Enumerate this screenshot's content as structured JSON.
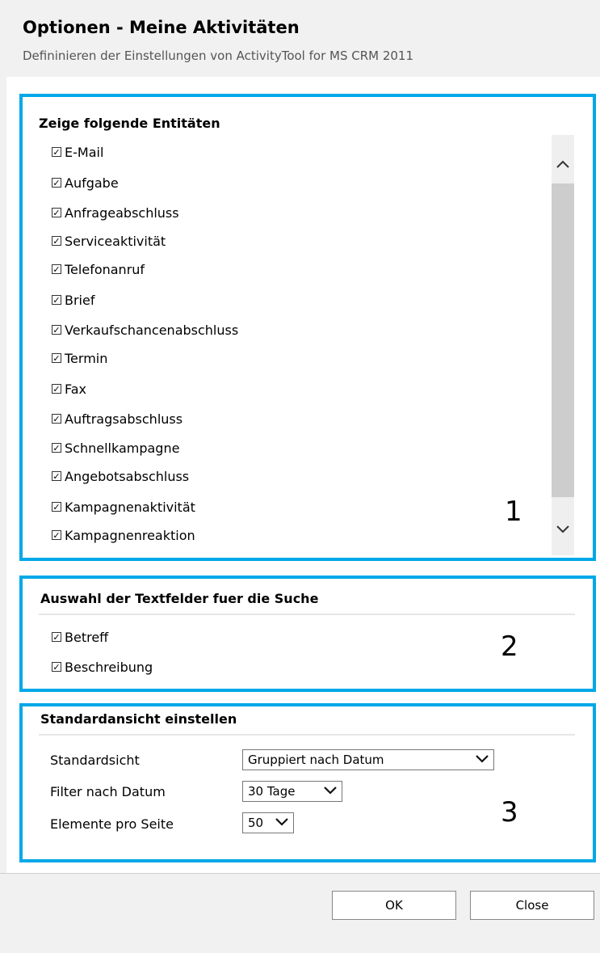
{
  "dialog": {
    "title": "Optionen - Meine Aktivitäten",
    "subtitle": "Defininieren der Einstellungen von ActivityTool for MS CRM 2011"
  },
  "entities_section": {
    "title": "Zeige folgende Entitäten",
    "items": [
      {
        "label": "E-Mail",
        "checked": true
      },
      {
        "label": "Aufgabe",
        "checked": true
      },
      {
        "label": "Anfrageabschluss",
        "checked": true
      },
      {
        "label": "Serviceaktivität",
        "checked": true
      },
      {
        "label": "Telefonanruf",
        "checked": true
      },
      {
        "label": "Brief",
        "checked": true
      },
      {
        "label": "Verkaufschancenabschluss",
        "checked": true
      },
      {
        "label": "Termin",
        "checked": true
      },
      {
        "label": "Fax",
        "checked": true
      },
      {
        "label": "Auftragsabschluss",
        "checked": true
      },
      {
        "label": "Schnellkampagne",
        "checked": true
      },
      {
        "label": "Angebotsabschluss",
        "checked": true
      },
      {
        "label": "Kampagnenaktivität",
        "checked": true
      },
      {
        "label": "Kampagnenreaktion",
        "checked": true
      }
    ],
    "annotation": "1"
  },
  "search_section": {
    "title": "Auswahl der Textfelder fuer die Suche",
    "items": [
      {
        "label": "Betreff",
        "checked": true
      },
      {
        "label": "Beschreibung",
        "checked": true
      }
    ],
    "annotation": "2"
  },
  "view_section": {
    "title": "Standardansicht einstellen",
    "rows": [
      {
        "label": "Standardsicht",
        "value": "Gruppiert nach Datum"
      },
      {
        "label": "Filter nach Datum",
        "value": "30 Tage"
      },
      {
        "label": "Elemente pro Seite",
        "value": "50"
      }
    ],
    "annotation": "3"
  },
  "footer": {
    "ok_label": "OK",
    "close_label": "Close"
  },
  "icons": {
    "checkbox_checked": "checkbox-checked-icon",
    "scroll_up": "chevron-up-icon",
    "scroll_down": "chevron-down-icon",
    "dropdown": "chevron-down-icon"
  },
  "colors": {
    "highlight_frame": "#00a8e8",
    "header_bg": "#f1f1f1"
  }
}
